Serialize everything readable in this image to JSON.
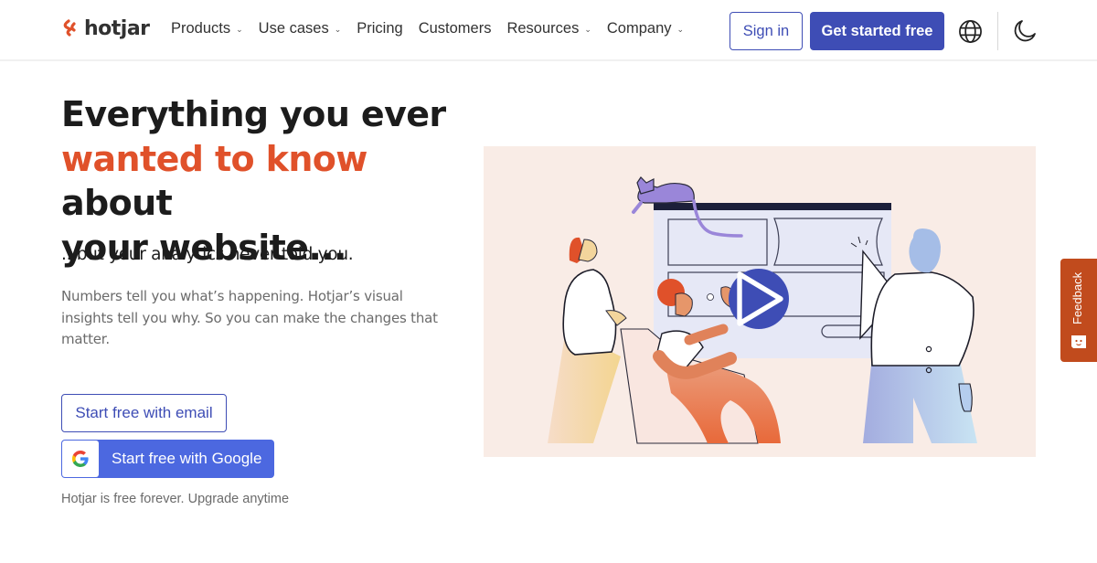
{
  "header": {
    "logo_text": "hotjar",
    "nav": [
      {
        "label": "Products",
        "has_dropdown": true
      },
      {
        "label": "Use cases",
        "has_dropdown": true
      },
      {
        "label": "Pricing",
        "has_dropdown": false
      },
      {
        "label": "Customers",
        "has_dropdown": false
      },
      {
        "label": "Resources",
        "has_dropdown": true
      },
      {
        "label": "Company",
        "has_dropdown": true
      }
    ],
    "chevron_glyph": "⌄",
    "sign_in_label": "Sign in",
    "get_started_label": "Get started free",
    "language_icon": "globe-icon",
    "theme_icon": "moon-icon"
  },
  "hero": {
    "title_line1": "Everything you ever",
    "title_accent": "wanted to know",
    "title_line2_rest": " about",
    "title_line3": "your website...",
    "subtitle": "...but your analytics never told you.",
    "description": "Numbers tell you what’s happening. Hotjar’s visual insights tell you why. So you can make the changes that matter.",
    "email_button_label": "Start free with email",
    "google_button_label": "Start free with Google",
    "free_note": "Hotjar is free forever. Upgrade anytime"
  },
  "illustration": {
    "play_icon": "play-icon"
  },
  "feedback": {
    "label": "Feedback"
  },
  "colors": {
    "brand_orange": "#e0512a",
    "primary_blue": "#3e4db5",
    "google_blue": "#4c68e0",
    "feedback_bg": "#c14b1d",
    "illustration_bg": "#f9ece6"
  }
}
